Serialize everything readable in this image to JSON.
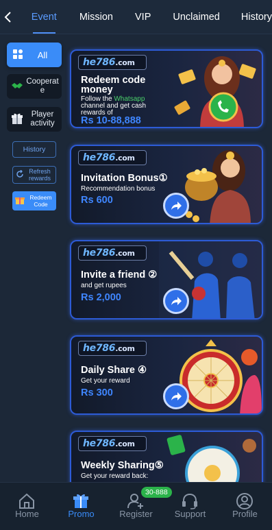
{
  "tabs": [
    "Event",
    "Mission",
    "VIP",
    "Unclaimed",
    "History"
  ],
  "sidebar": {
    "all": "All",
    "cooperate": "Cooperat e",
    "player_activity": "Player activity",
    "history": "History",
    "refresh": "Refresh rewards",
    "redeem": "Redeem Code"
  },
  "logo": {
    "brand": "he786",
    "tld": ".com"
  },
  "cards": [
    {
      "title1": "Redeem code",
      "title2": "money",
      "sub1a": "Follow the ",
      "sub1b": "Whatsapp",
      "sub2": "channel and get cash",
      "sub3": "rewards of",
      "amount": "Rs 10-88,888"
    },
    {
      "title": "Invitation Bonus①",
      "sub": "Recommendation bonus",
      "amount": "Rs 600"
    },
    {
      "title": "Invite a friend ②",
      "sub": "and get rupees",
      "amount": "Rs 2,000"
    },
    {
      "title": "Daily Share ④",
      "sub": "Get your reward",
      "amount": "Rs 300"
    },
    {
      "title": "Weekly Sharing⑤",
      "sub": "Get your reward back:"
    }
  ],
  "bottom_nav": {
    "items": [
      "Home",
      "Promo",
      "Register",
      "Support",
      "Profile"
    ],
    "badge": "30-888"
  },
  "colors": {
    "accent": "#3a8cf8",
    "background": "#1c2838",
    "badge": "#2bb34a"
  }
}
